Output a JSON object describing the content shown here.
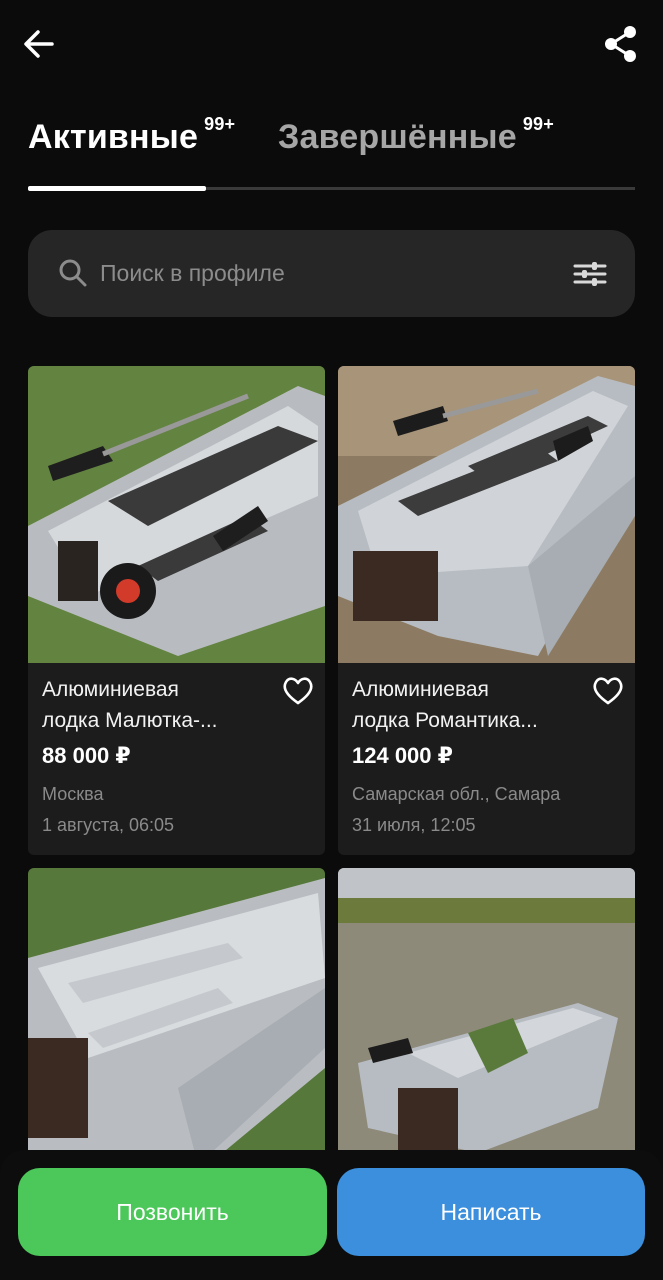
{
  "tabs": [
    {
      "label": "Активные",
      "count": "99+"
    },
    {
      "label": "Завершённые",
      "count": "99+"
    }
  ],
  "search": {
    "placeholder": "Поиск в профиле"
  },
  "listings": [
    {
      "title_line1": "Алюминиевая",
      "title_line2": "лодка Малютка-...",
      "price": "88 000 ₽",
      "location": "Москва",
      "date": "1 августа, 06:05"
    },
    {
      "title_line1": "Алюминиевая",
      "title_line2": "лодка Романтика...",
      "price": "124 000 ₽",
      "location": "Самарская обл., Самара",
      "date": "31 июля, 12:05"
    },
    {
      "title_line1": "",
      "title_line2": "",
      "price": "",
      "location": "",
      "date": ""
    },
    {
      "title_line1": "",
      "title_line2": "",
      "price": "",
      "location": "",
      "date": ""
    }
  ],
  "actions": {
    "call_label": "Позвонить",
    "write_label": "Написать"
  },
  "colors": {
    "call": "#4cc75a",
    "write": "#3b8fdc",
    "background": "#0b0b0b"
  }
}
